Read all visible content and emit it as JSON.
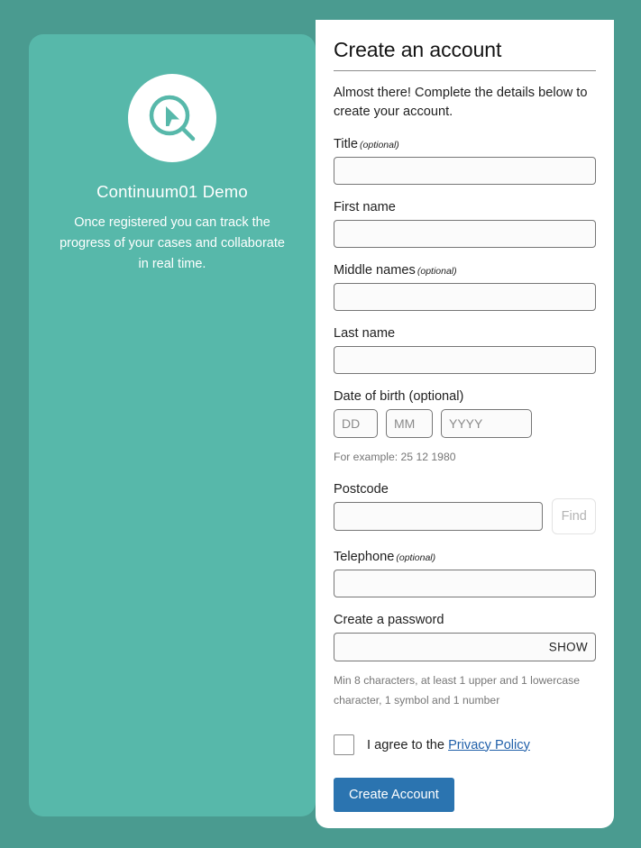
{
  "brand": {
    "logo_icon": "magnifier-cursor-logo-icon",
    "name": "Continuum01 Demo",
    "tagline": "Once registered you can track the progress of your cases and collaborate in real time.",
    "panel_color": "#57b8aa",
    "page_background_color": "#4a9b90"
  },
  "form": {
    "title": "Create an account",
    "intro": "Almost there! Complete the details below to create your account.",
    "fields": {
      "title": {
        "label": "Title",
        "optional_tag": "(optional)",
        "value": "",
        "placeholder": ""
      },
      "first_name": {
        "label": "First name",
        "value": "",
        "placeholder": ""
      },
      "middle_names": {
        "label": "Middle names",
        "optional_tag": "(optional)",
        "value": "",
        "placeholder": ""
      },
      "last_name": {
        "label": "Last name",
        "value": "",
        "placeholder": ""
      },
      "date_of_birth": {
        "label": "Date of birth (optional)",
        "day_placeholder": "DD",
        "month_placeholder": "MM",
        "year_placeholder": "YYYY",
        "day_value": "",
        "month_value": "",
        "year_value": "",
        "hint": "For example: 25 12 1980"
      },
      "postcode": {
        "label": "Postcode",
        "value": "",
        "placeholder": "",
        "find_button_label": "Find"
      },
      "telephone": {
        "label": "Telephone",
        "optional_tag": "(optional)",
        "value": "",
        "placeholder": ""
      },
      "password": {
        "label": "Create a password",
        "value": "",
        "placeholder": "",
        "show_toggle_label": "SHOW",
        "hint": "Min 8 characters, at least 1 upper and 1 lowercase character, 1 symbol and 1 number"
      }
    },
    "agreement": {
      "checked": false,
      "text_before_link": "I agree to the ",
      "link_label": "Privacy Policy",
      "link_color": "#1f5fa9"
    },
    "submit_button": {
      "label": "Create Account",
      "color": "#2b74b0"
    }
  }
}
